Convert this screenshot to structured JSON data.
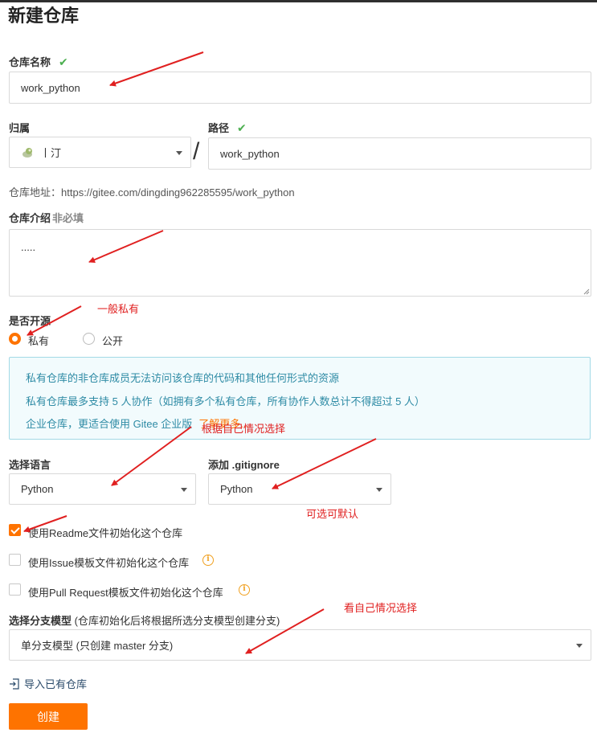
{
  "page": {
    "title": "新建仓库"
  },
  "repo_name": {
    "label": "仓库名称",
    "value": "work_python"
  },
  "owner": {
    "label": "归属",
    "value": "丨汀"
  },
  "path": {
    "label": "路径",
    "value": "work_python",
    "separator": "/"
  },
  "repo_url": {
    "label": "仓库地址：",
    "value": "https://gitee.com/dingding962285595/work_python"
  },
  "description": {
    "label": "仓库介绍",
    "optional": "非必填",
    "value": "....."
  },
  "visibility": {
    "label": "是否开源",
    "options": [
      {
        "label": "私有",
        "selected": true
      },
      {
        "label": "公开",
        "selected": false
      }
    ]
  },
  "info_box": {
    "line1": "私有仓库的非仓库成员无法访问该仓库的代码和其他任何形式的资源",
    "line2": "私有仓库最多支持 5 人协作（如拥有多个私有仓库，所有协作人数总计不得超过 5 人）",
    "line3": "企业仓库，更适合使用 Gitee 企业版",
    "learn_more": "了解更多..."
  },
  "language": {
    "label": "选择语言",
    "value": "Python"
  },
  "gitignore": {
    "label": "添加 .gitignore",
    "value": "Python"
  },
  "init_options": [
    {
      "label": "使用Readme文件初始化这个仓库",
      "checked": true
    },
    {
      "label": "使用Issue模板文件初始化这个仓库",
      "checked": false
    },
    {
      "label": "使用Pull Request模板文件初始化这个仓库",
      "checked": false
    }
  ],
  "branch_model": {
    "label": "选择分支模型",
    "hint": "(仓库初始化后将根据所选分支模型创建分支)",
    "value": "单分支模型 (只创建 master 分支)"
  },
  "import_link": "导入已有仓库",
  "create_button": "创建",
  "annotations": {
    "private": "一般私有",
    "language": "根据自己情况选择",
    "gitignore": "可选可默认",
    "branch": "看自己情况选择"
  },
  "colors": {
    "accent": "#fe7300",
    "check": "#4caf50",
    "annotation": "#e02020",
    "info_text": "#2e8ba5"
  }
}
